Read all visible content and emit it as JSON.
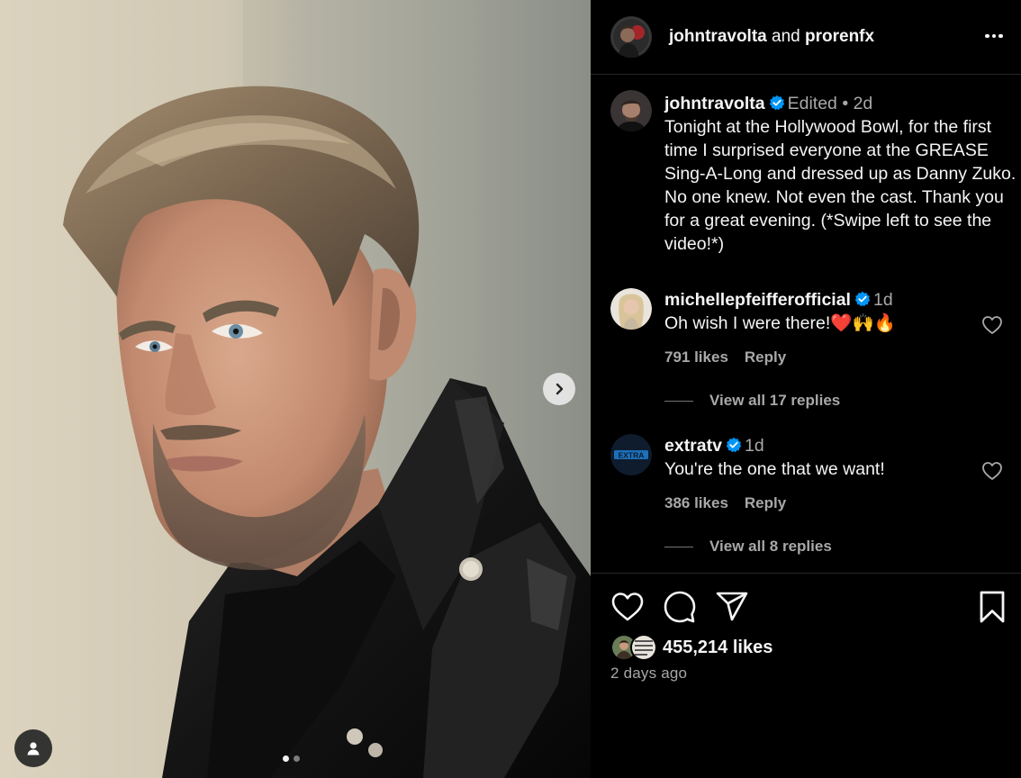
{
  "header": {
    "user1": "johntravolta",
    "and": "and",
    "user2": "prorenfx"
  },
  "caption": {
    "username": "johntravolta",
    "edited": "Edited",
    "separator": "•",
    "time": "2d",
    "text": "Tonight at the Hollywood Bowl, for the first time I surprised everyone at the GREASE Sing-A-Long and dressed up as Danny Zuko. No one knew. Not even the cast. Thank you for a great evening. (*Swipe left to see the video!*)"
  },
  "comments": [
    {
      "username": "michellepfeifferofficial",
      "time": "1d",
      "text": "Oh wish I were there!❤️🙌🔥",
      "likes": "791 likes",
      "reply": "Reply",
      "view_replies": "View all 17 replies"
    },
    {
      "username": "extratv",
      "avatar_text": "EXTRA",
      "time": "1d",
      "text": "You're the one that we want!",
      "likes": "386 likes",
      "reply": "Reply",
      "view_replies": "View all 8 replies"
    }
  ],
  "post": {
    "likes": "455,214 likes",
    "time_ago": "2 days ago"
  },
  "icons": {
    "like": "heart-icon",
    "comment": "comment-icon",
    "share": "share-icon",
    "save": "bookmark-icon",
    "more": "more-options-icon",
    "verified": "verified-badge-icon",
    "next": "chevron-right-icon",
    "tagged": "user-tag-icon"
  },
  "colors": {
    "background": "#000000",
    "text": "#f5f5f5",
    "muted": "#a8a8a8",
    "verified": "#0095f6",
    "divider": "#262626"
  }
}
